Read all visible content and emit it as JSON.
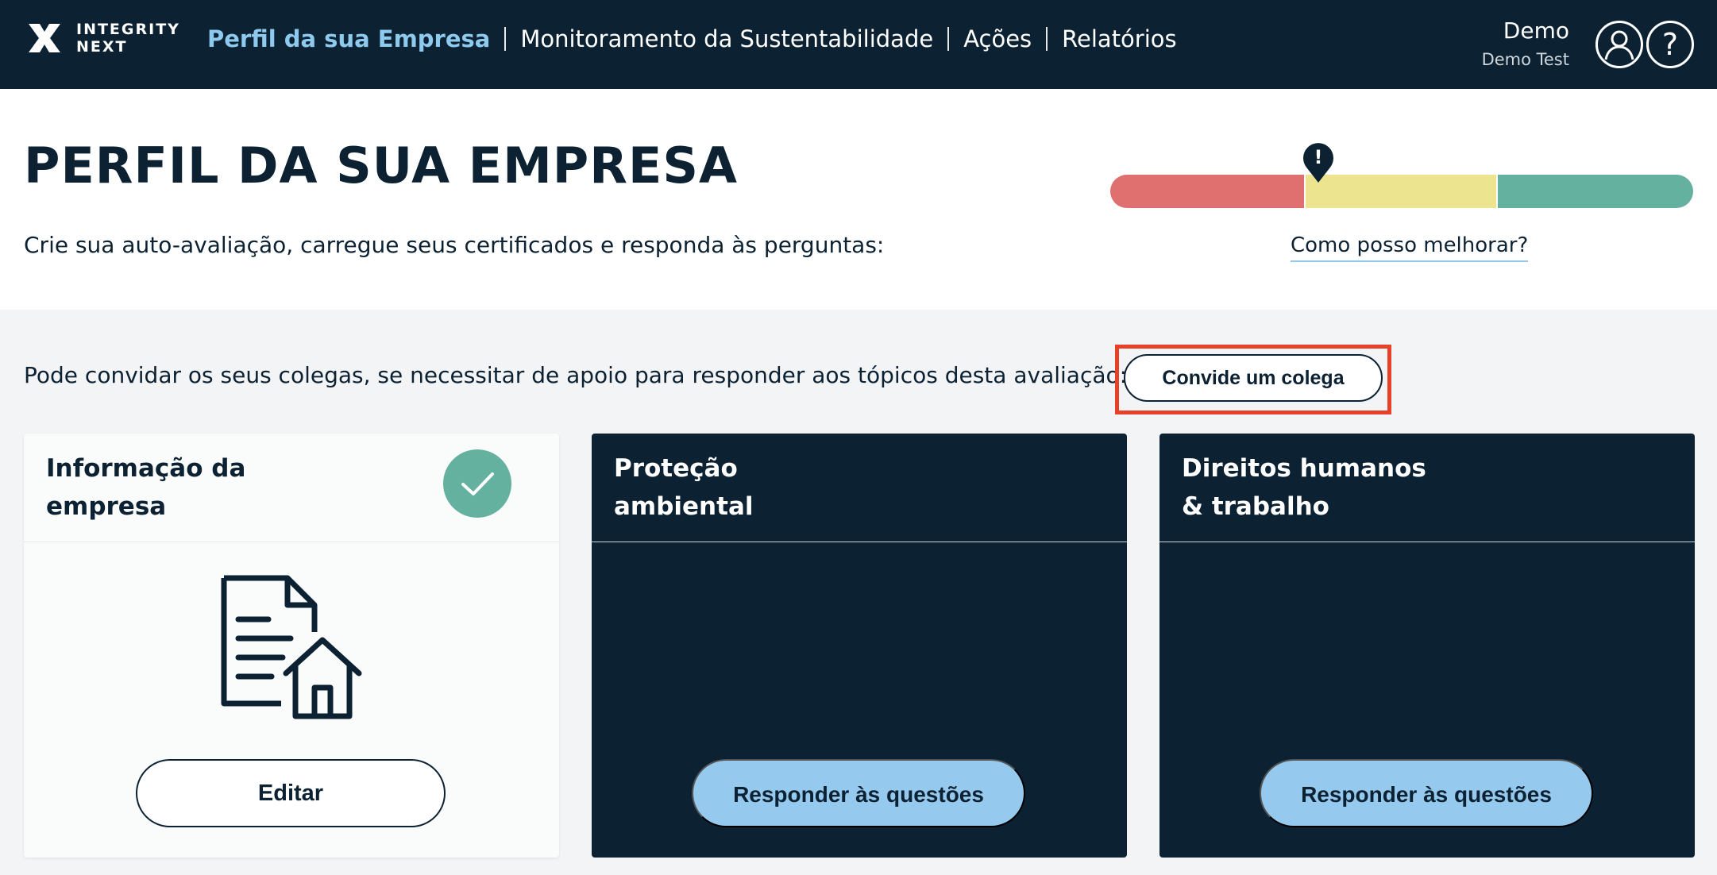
{
  "header": {
    "logo_line1": "INTEGRITY",
    "logo_line2": "NEXT",
    "nav": [
      {
        "label": "Perfil da sua Empresa",
        "active": true
      },
      {
        "label": "Monitoramento da Sustentabilidade",
        "active": false
      },
      {
        "label": "Ações",
        "active": false
      },
      {
        "label": "Relatórios",
        "active": false
      }
    ],
    "user": {
      "name": "Demo",
      "company": "Demo Test"
    },
    "help_icon": "?"
  },
  "hero": {
    "title": "PERFIL DA SUA EMPRESA",
    "subtitle": "Crie sua auto-avaliação, carregue seus certificados e responda às perguntas:",
    "progress": {
      "segments": [
        "#e07070",
        "#ede48f",
        "#64b1a0"
      ],
      "marker_symbol": "!",
      "level": "yellow"
    },
    "improve_link": "Como posso melhorar?"
  },
  "invite": {
    "text": "Pode convidar os seus colegas, se necessitar de apoio para responder aos tópicos desta avaliação:",
    "button": "Convide um colega",
    "highlight_color": "#e8412a"
  },
  "cards": [
    {
      "title_line1": "Informação da",
      "title_line2": "empresa",
      "completed": true,
      "button": "Editar",
      "icon": "document-home-icon"
    },
    {
      "title_line1": "Proteção",
      "title_line2": "ambiental",
      "button": "Responder às questões"
    },
    {
      "title_line1": "Direitos humanos",
      "title_line2": "& trabalho",
      "button": "Responder às questões"
    }
  ],
  "colors": {
    "navy": "#0c2132",
    "accent_blue": "#8ec9ee",
    "button_blue": "#95c9ee",
    "green": "#64b1a0"
  }
}
